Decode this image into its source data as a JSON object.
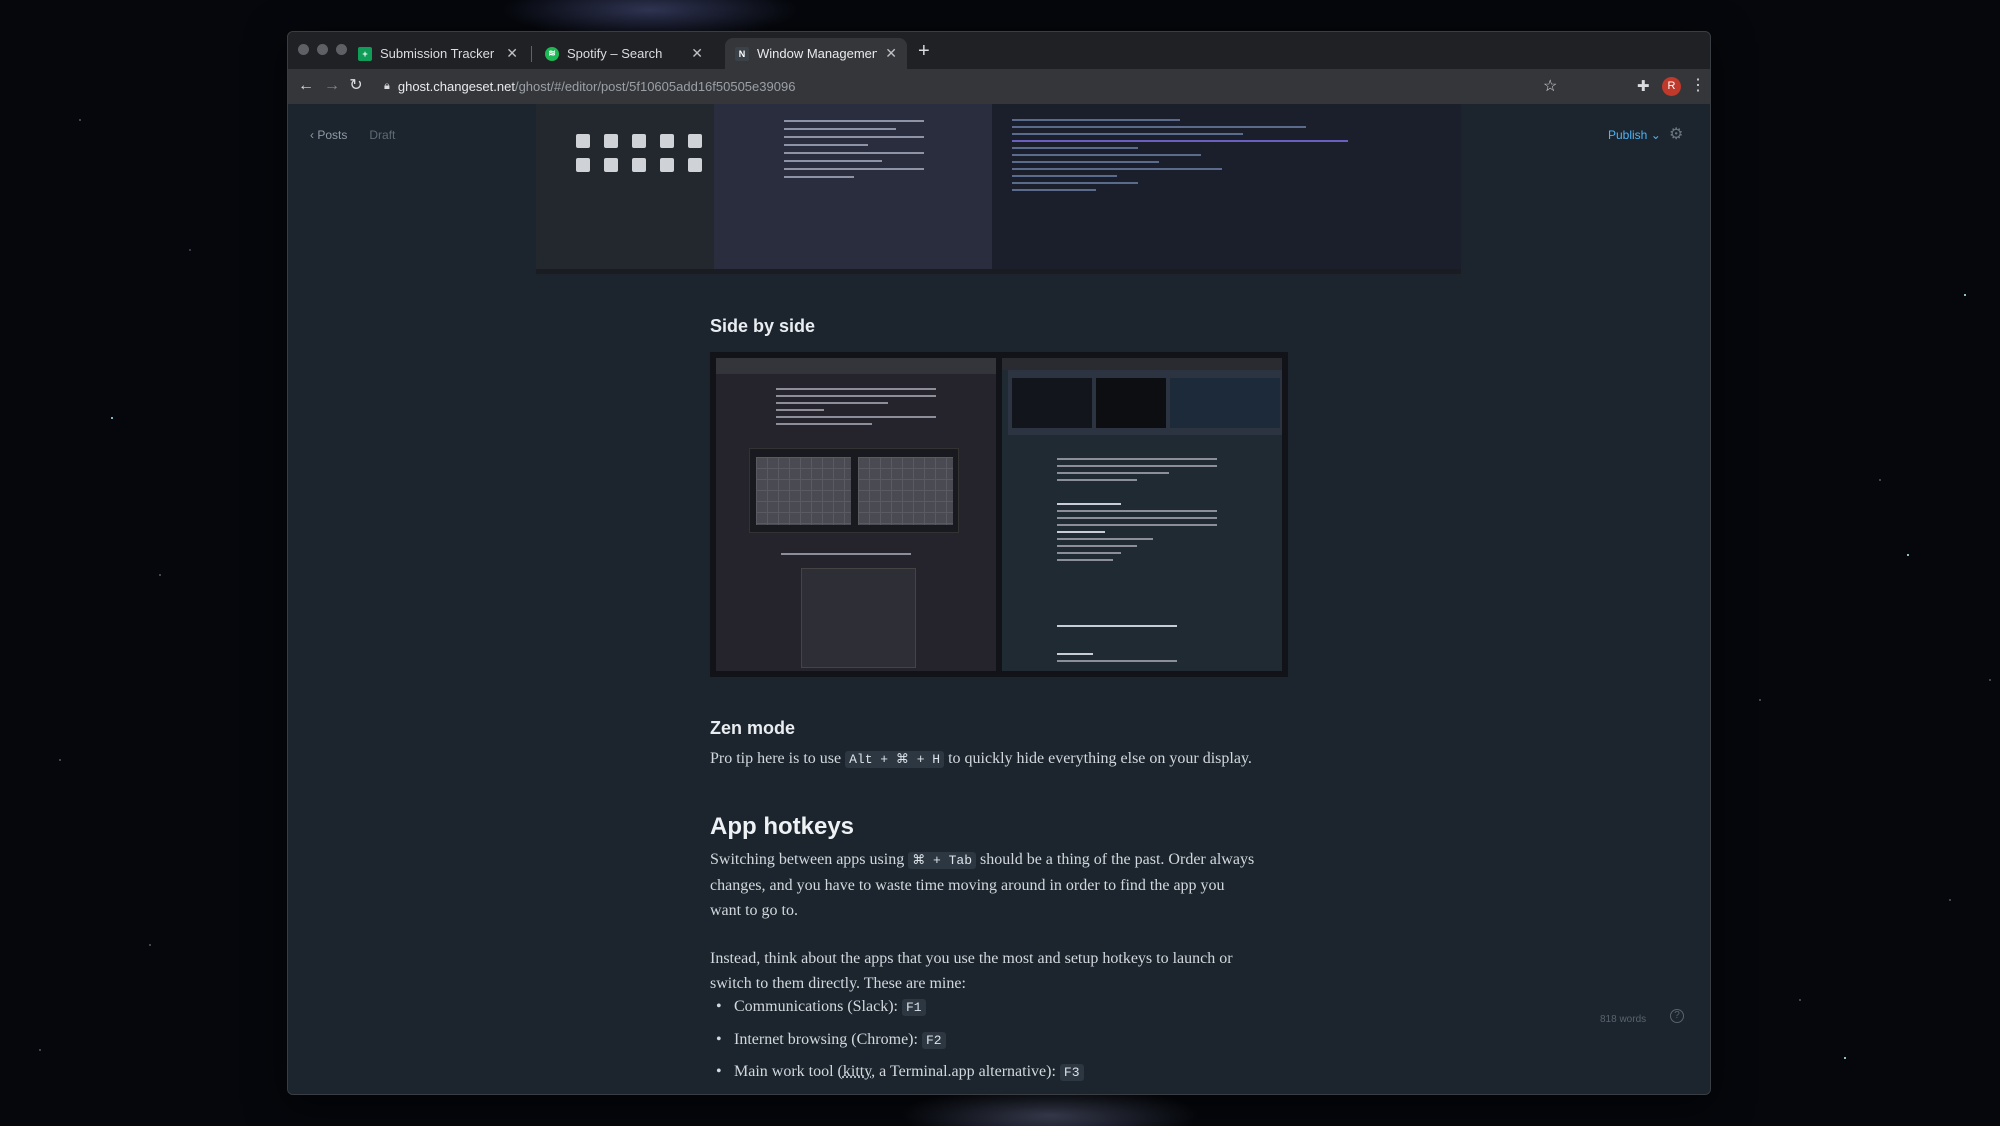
{
  "browser": {
    "tabs": [
      {
        "title": "Submission Tracker + Content",
        "favicon_color": "#0f9d58",
        "favicon": "sheets-icon"
      },
      {
        "title": "Spotify – Search",
        "favicon_color": "#1db954",
        "favicon": "spotify-icon"
      },
      {
        "title": "Window Management in macOS",
        "favicon_color": "#3b4149",
        "favicon": "ghost-icon",
        "active": true
      }
    ],
    "url_host": "ghost.changeset.net",
    "url_path": "/ghost/#/editor/post/5f10605add16f50505e39096",
    "profile_initial": "R"
  },
  "editor": {
    "back_label": "Posts",
    "status": "Draft",
    "publish_label": "Publish",
    "word_count": "818 words",
    "help_label": "?"
  },
  "article": {
    "side_by_side_heading": "Side by side",
    "zen_heading": "Zen mode",
    "zen_text_before": "Pro tip here is to use",
    "zen_code": "Alt + ⌘ + H",
    "zen_text_after": "to quickly hide everything else on your display.",
    "hotkeys_heading": "App hotkeys",
    "hotkeys_p1_before": "Switching between apps using",
    "hotkeys_p1_code": "⌘ + Tab",
    "hotkeys_p1_after_line1": "should be a thing of the past. Order always",
    "hotkeys_p1_line2": "changes, and you have to waste time moving around in order to find the app you",
    "hotkeys_p1_line3": "want to go to.",
    "hotkeys_p2_line1": "Instead, think about the apps that you use the most and setup hotkeys to launch or",
    "hotkeys_p2_line2": "switch to them directly. These are mine:",
    "list": [
      {
        "text": "Communications (Slack):",
        "key": "F1"
      },
      {
        "text_before": "Internet browsing (Chrome):",
        "key": "F2"
      },
      {
        "text_before": "Main work tool (",
        "link": "kitty",
        "text_after": ", a Terminal.app alternative):",
        "key": "F3"
      }
    ]
  },
  "colors": {
    "accent": "#4fb3f6",
    "editor_bg": "#1c252d"
  }
}
